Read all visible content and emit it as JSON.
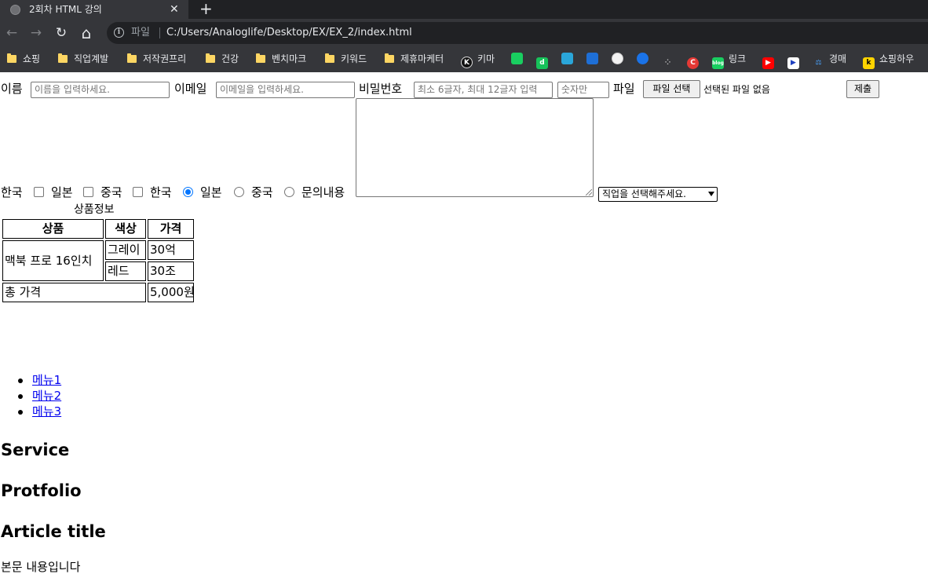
{
  "browser": {
    "tab_title": "2회차 HTML 강의",
    "tab_close": "✕",
    "new_tab": "+",
    "nav": {
      "back": "←",
      "forward": "→",
      "reload": "↻",
      "home": "⌂"
    },
    "info_glyph": "i",
    "url_scheme": "파일",
    "url": "C:/Users/Analoglife/Desktop/EX/EX_2/index.html",
    "bookmarks": [
      {
        "label": "쇼핑",
        "icon": "folder"
      },
      {
        "label": "직업계발",
        "icon": "folder"
      },
      {
        "label": "저작권프리",
        "icon": "folder"
      },
      {
        "label": "건강",
        "icon": "folder"
      },
      {
        "label": "벤치마크",
        "icon": "folder"
      },
      {
        "label": "키워드",
        "icon": "folder"
      },
      {
        "label": "제휴마케터",
        "icon": "folder"
      },
      {
        "label": "키마",
        "icon": "k-favicon"
      },
      {
        "label": "링크",
        "icon": "blog-favicon"
      },
      {
        "label": "경매",
        "icon": "auction-favicon"
      },
      {
        "label": "쇼핑하우",
        "icon": "k-yellow-favicon"
      }
    ],
    "favicon_glyphs": {
      "k": "K",
      "d": "d",
      "c": "C",
      "blog": "blog",
      "ky": "k"
    }
  },
  "form": {
    "name_label": "이름",
    "name_placeholder": "이름을 입력하세요.",
    "email_label": "이메일",
    "email_placeholder": "이메일을 입력하세요.",
    "password_label": "비밀번호",
    "password_placeholder": "최소 6글자, 최대 12글자 입력",
    "number_placeholder": "숫자만",
    "file_label": "파일",
    "file_button": "파일 선택",
    "file_status": "선택된 파일 없음",
    "submit_button": "제출",
    "checkboxes": [
      "한국",
      "일본",
      "중국"
    ],
    "radios": [
      "한국",
      "일본",
      "중국"
    ],
    "radio_selected": "한국",
    "inquiry_label": "문의내용",
    "job_select": "직업을 선택해주세요."
  },
  "table": {
    "caption": "상품정보",
    "headers": [
      "상품",
      "색상",
      "가격"
    ],
    "product": "맥북 프로 16인치",
    "rows": [
      {
        "color": "그레이",
        "price": "30억"
      },
      {
        "color": "레드",
        "price": "30조"
      }
    ],
    "total_label": "총 가격",
    "total_value": "5,000원"
  },
  "menu": [
    "메뉴1",
    "메뉴2",
    "메뉴3"
  ],
  "headings": [
    "Service",
    "Protfolio",
    "Article title"
  ],
  "body_text": "본문 내용입니다"
}
